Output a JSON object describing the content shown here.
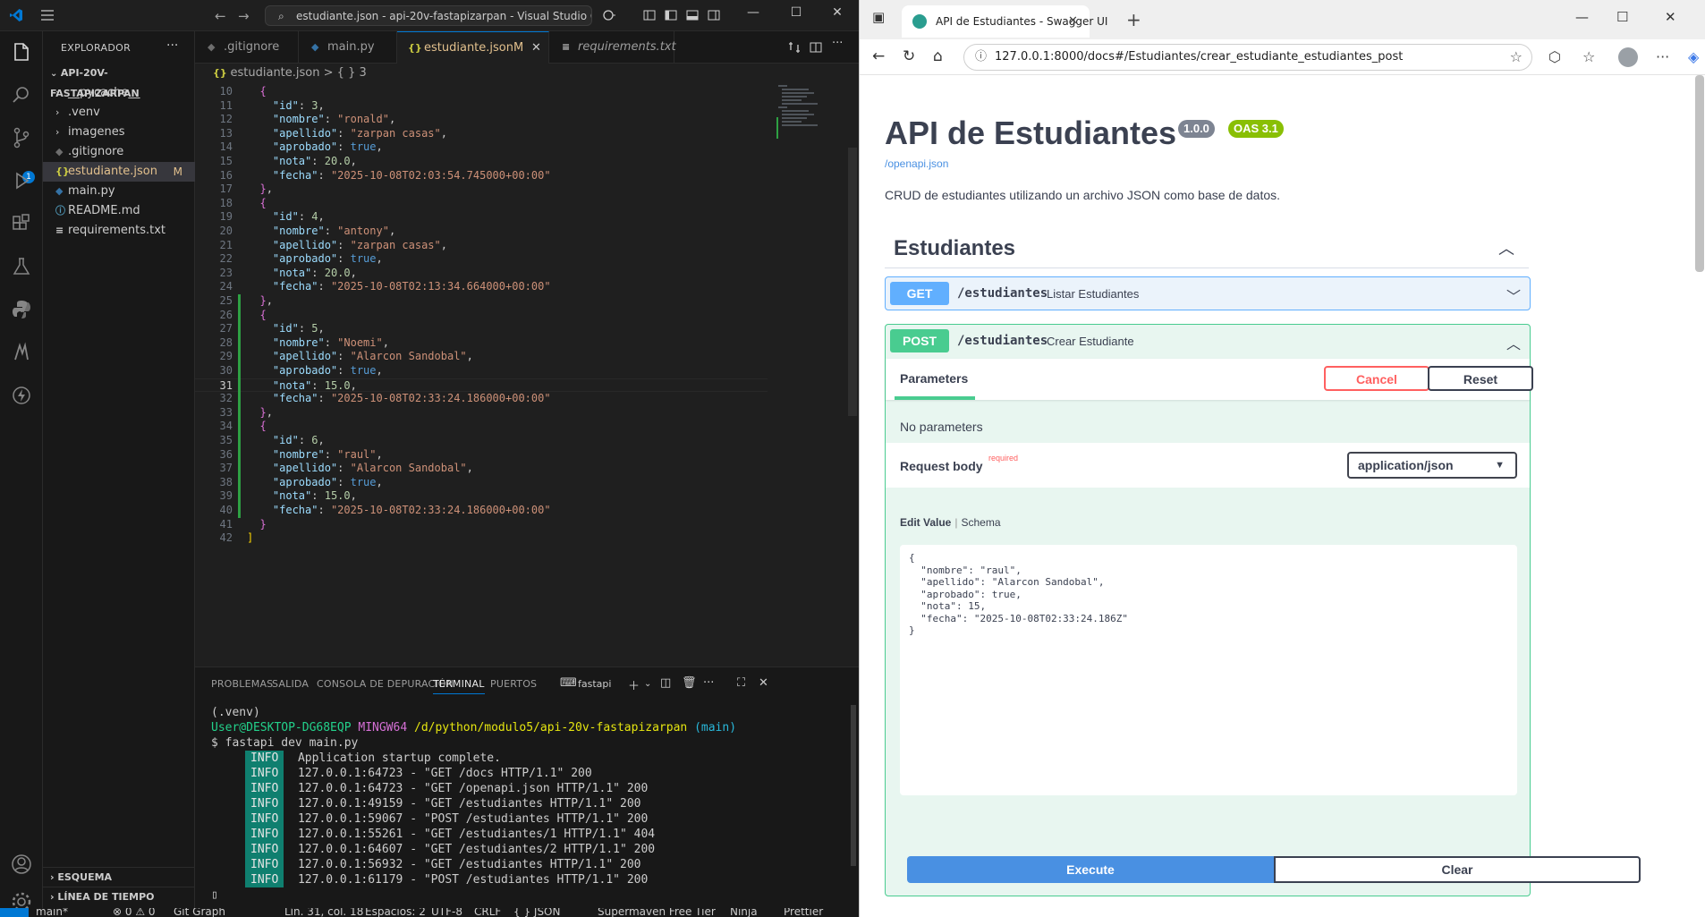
{
  "vscode": {
    "title": "estudiante.json - api-20v-fastapizarpan - Visual Studio Code",
    "explorer_title": "EXPLORADOR",
    "project": "API-20V-FASTAPIZARPAN",
    "tree": [
      {
        "label": "__pycache__",
        "icon": "chevron-right"
      },
      {
        "label": ".venv",
        "icon": "chevron-right"
      },
      {
        "label": "imagenes",
        "icon": "chevron-right"
      },
      {
        "label": ".gitignore",
        "icon": "gitignore-icon"
      },
      {
        "label": "estudiante.json",
        "icon": "json-icon",
        "modified": "M"
      },
      {
        "label": "main.py",
        "icon": "python-icon"
      },
      {
        "label": "README.md",
        "icon": "info-icon"
      },
      {
        "label": "requirements.txt",
        "icon": "text-icon"
      }
    ],
    "sections": [
      "ESQUEMA",
      "LÍNEA DE TIEMPO"
    ],
    "tabs": [
      {
        "label": ".gitignore"
      },
      {
        "label": "main.py"
      },
      {
        "label": "estudiante.json",
        "modified": "M"
      },
      {
        "label": "requirements.txt"
      }
    ],
    "breadcrumb": {
      "file": "estudiante.json",
      "sep": ">",
      "node": "{ } 3"
    },
    "code_lines": [
      {
        "n": "10",
        "t": "  {"
      },
      {
        "n": "11",
        "t": "    \"id\": 3,"
      },
      {
        "n": "12",
        "t": "    \"nombre\": \"ronald\","
      },
      {
        "n": "13",
        "t": "    \"apellido\": \"zarpan casas\","
      },
      {
        "n": "14",
        "t": "    \"aprobado\": true,"
      },
      {
        "n": "15",
        "t": "    \"nota\": 20.0,"
      },
      {
        "n": "16",
        "t": "    \"fecha\": \"2025-10-08T02:03:54.745000+00:00\""
      },
      {
        "n": "17",
        "t": "  },"
      },
      {
        "n": "18",
        "t": "  {"
      },
      {
        "n": "19",
        "t": "    \"id\": 4,"
      },
      {
        "n": "20",
        "t": "    \"nombre\": \"antony\","
      },
      {
        "n": "21",
        "t": "    \"apellido\": \"zarpan casas\","
      },
      {
        "n": "22",
        "t": "    \"aprobado\": true,"
      },
      {
        "n": "23",
        "t": "    \"nota\": 20.0,"
      },
      {
        "n": "24",
        "t": "    \"fecha\": \"2025-10-08T02:13:34.664000+00:00\""
      },
      {
        "n": "25",
        "t": "  },"
      },
      {
        "n": "26",
        "t": "  {"
      },
      {
        "n": "27",
        "t": "    \"id\": 5,"
      },
      {
        "n": "28",
        "t": "    \"nombre\": \"Noemi\","
      },
      {
        "n": "29",
        "t": "    \"apellido\": \"Alarcon Sandobal\","
      },
      {
        "n": "30",
        "t": "    \"aprobado\": true,"
      },
      {
        "n": "31",
        "t": "    \"nota\": 15.0,"
      },
      {
        "n": "32",
        "t": "    \"fecha\": \"2025-10-08T02:33:24.186000+00:00\""
      },
      {
        "n": "33",
        "t": "  },"
      },
      {
        "n": "34",
        "t": "  {"
      },
      {
        "n": "35",
        "t": "    \"id\": 6,"
      },
      {
        "n": "36",
        "t": "    \"nombre\": \"raul\","
      },
      {
        "n": "37",
        "t": "    \"apellido\": \"Alarcon Sandobal\","
      },
      {
        "n": "38",
        "t": "    \"aprobado\": true,"
      },
      {
        "n": "39",
        "t": "    \"nota\": 15.0,"
      },
      {
        "n": "40",
        "t": "    \"fecha\": \"2025-10-08T02:33:24.186000+00:00\""
      },
      {
        "n": "41",
        "t": "  }"
      },
      {
        "n": "42",
        "t": "]"
      }
    ],
    "current_line": "31",
    "panel_tabs": [
      "PROBLEMAS",
      "SALIDA",
      "CONSOLA DE DEPURACIÓN",
      "TERMINAL",
      "PUERTOS"
    ],
    "terminal_name": "fastapi",
    "terminal": {
      "venv": "(.venv)",
      "user": "User@DESKTOP-DG68EQP",
      "shell": "MINGW64",
      "path": "/d/python/modulo5/api-20v-fastapizarpan",
      "branch": "(main)",
      "cmd": "$ fastapi dev main.py",
      "info_tag": "INFO",
      "logs": [
        "Application startup complete.",
        "127.0.0.1:64723 - \"GET /docs HTTP/1.1\" 200",
        "127.0.0.1:64723 - \"GET /openapi.json HTTP/1.1\" 200",
        "127.0.0.1:49159 - \"GET /estudiantes HTTP/1.1\" 200",
        "127.0.0.1:59067 - \"POST /estudiantes HTTP/1.1\" 200",
        "127.0.0.1:55261 - \"GET /estudiantes/1 HTTP/1.1\" 404",
        "127.0.0.1:64607 - \"GET /estudiantes/2 HTTP/1.1\" 200",
        "127.0.0.1:56932 - \"GET /estudiantes HTTP/1.1\" 200",
        "127.0.0.1:61179 - \"POST /estudiantes HTTP/1.1\" 200"
      ]
    },
    "status": [
      "main*",
      "⊗ 0 ⚠ 0",
      "Git Graph",
      "Lín. 31, col. 18",
      "Espacios: 2",
      "UTF-8",
      "CRLF",
      "{ } JSON",
      "Supermaven Free Tier",
      "Ninja",
      "Prettier"
    ]
  },
  "browser": {
    "tab_title": "API de Estudiantes - Swagger UI",
    "url": "127.0.0.1:8000/docs#/Estudiantes/crear_estudiante_estudiantes_post"
  },
  "swagger": {
    "title": "API de Estudiantes",
    "version": "1.0.0",
    "oas": "OAS 3.1",
    "openapi_link": "/openapi.json",
    "description": "CRUD de estudiantes utilizando un archivo JSON como base de datos.",
    "tag": "Estudiantes",
    "get": {
      "method": "GET",
      "path": "/estudiantes",
      "summary": "Listar Estudiantes"
    },
    "post": {
      "method": "POST",
      "path": "/estudiantes",
      "summary": "Crear Estudiante"
    },
    "parameters_label": "Parameters",
    "cancel_label": "Cancel",
    "reset_label": "Reset",
    "no_params": "No parameters",
    "request_body": "Request body",
    "required": "required",
    "content_type": "application/json",
    "edit_value": "Edit Value",
    "schema": "Schema",
    "body_lines": [
      "{",
      "  \"nombre\": \"raul\",",
      "  \"apellido\": \"Alarcon Sandobal\",",
      "  \"aprobado\": true,",
      "  \"nota\": 15,",
      "  \"fecha\": \"2025-10-08T02:33:24.186Z\"",
      "}"
    ],
    "execute_label": "Execute",
    "clear_label": "Clear",
    "colors": {
      "get": "#61affe",
      "post": "#49cc90",
      "version": "#7d8492",
      "oas": "#89bf04"
    }
  }
}
